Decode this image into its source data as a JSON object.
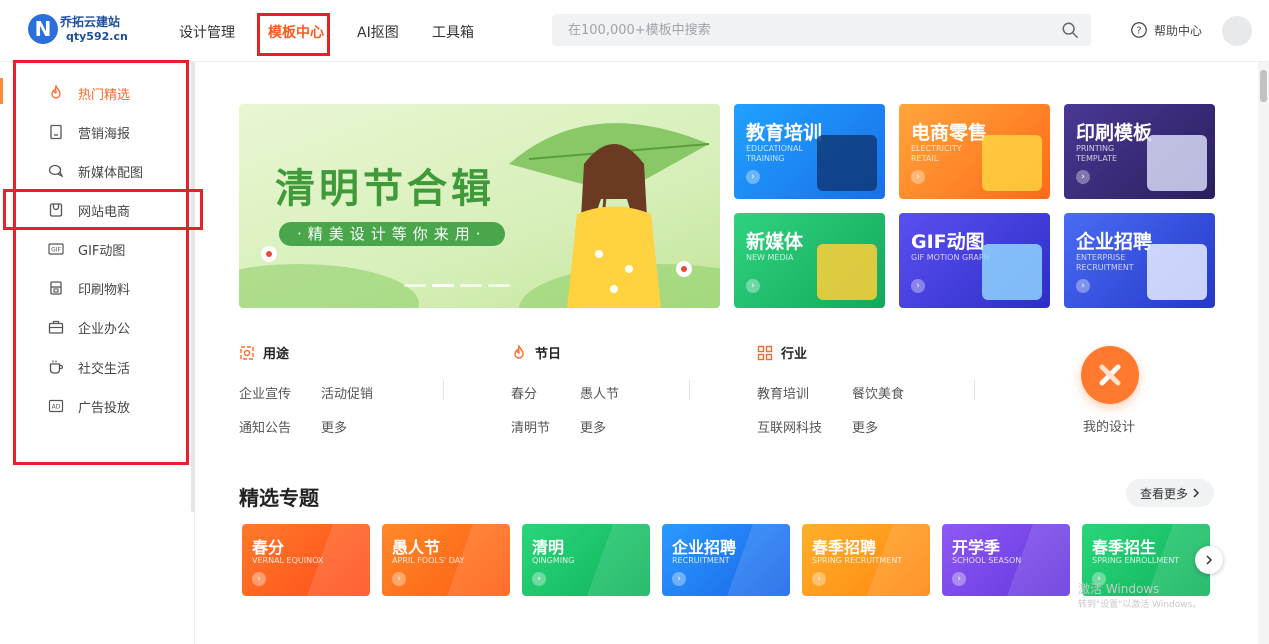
{
  "header": {
    "logo_mark": "N",
    "logo_name": "乔拓云建站",
    "logo_url": "qty592.cn",
    "nav": [
      "设计管理",
      "模板中心",
      "AI抠图",
      "工具箱"
    ],
    "active_nav": "模板中心",
    "search_placeholder": "在100,000+模板中搜索",
    "help_label": "帮助中心"
  },
  "sidebar": {
    "items": [
      {
        "label": "热门精选",
        "icon": "fire-icon",
        "active": true
      },
      {
        "label": "营销海报",
        "icon": "poster-icon"
      },
      {
        "label": "新媒体配图",
        "icon": "chat-icon"
      },
      {
        "label": "网站电商",
        "icon": "shopping-icon"
      },
      {
        "label": "GIF动图",
        "icon": "gif-icon"
      },
      {
        "label": "印刷物料",
        "icon": "printer-icon"
      },
      {
        "label": "企业办公",
        "icon": "briefcase-icon"
      },
      {
        "label": "社交生活",
        "icon": "cup-icon"
      },
      {
        "label": "广告投放",
        "icon": "ad-icon"
      }
    ]
  },
  "banner": {
    "title": "清明节合辑",
    "subtitle": "·精美设计等你来用·"
  },
  "tiles": [
    {
      "title": "教育培训",
      "en": "EDUCATIONAL TRAINING",
      "color": "#1d8ff0"
    },
    {
      "title": "电商零售",
      "en": "ELECTRICITY RETAIL",
      "color": "#ff8a1f"
    },
    {
      "title": "印刷模板",
      "en": "PRINTING TEMPLATE",
      "color": "#3b2c7a"
    },
    {
      "title": "新媒体",
      "en": "NEW MEDIA",
      "color": "#1fbf7a"
    },
    {
      "title": "GIF动图",
      "en": "GIF MOTION GRAPH",
      "color": "#3b3fe0"
    },
    {
      "title": "企业招聘",
      "en": "ENTERPRISE RECRUITMENT",
      "color": "#2f52e8"
    }
  ],
  "categories": [
    {
      "name": "用途",
      "icon": "purpose-icon",
      "links": [
        "企业宣传",
        "活动促销",
        "通知公告",
        "更多"
      ]
    },
    {
      "name": "节日",
      "icon": "fire-icon",
      "links": [
        "春分",
        "愚人节",
        "清明节",
        "更多"
      ]
    },
    {
      "name": "行业",
      "icon": "grid-icon",
      "links": [
        "教育培训",
        "餐饮美食",
        "互联网科技",
        "更多"
      ]
    }
  ],
  "my_design_label": "我的设计",
  "featured": {
    "title": "精选专题",
    "more_label": "查看更多",
    "topics": [
      {
        "title": "春分",
        "en": "VERNAL EQUINOX",
        "color": "#ff5a1f"
      },
      {
        "title": "愚人节",
        "en": "APRIL FOOLS' DAY",
        "color": "#ff6a10"
      },
      {
        "title": "清明",
        "en": "QINGMING",
        "color": "#14c46a"
      },
      {
        "title": "企业招聘",
        "en": "RECRUITMENT",
        "color": "#1f7ff5"
      },
      {
        "title": "春季招聘",
        "en": "SPRING RECRUITMENT",
        "color": "#ff9a10"
      },
      {
        "title": "开学季",
        "en": "SCHOOL SEASON",
        "color": "#7b45e6"
      },
      {
        "title": "春季招生",
        "en": "SPRING ENROLLMENT",
        "color": "#14c46a"
      }
    ]
  },
  "watermark": {
    "line1": "激活 Windows",
    "line2": "转到\"设置\"以激活 Windows。"
  }
}
